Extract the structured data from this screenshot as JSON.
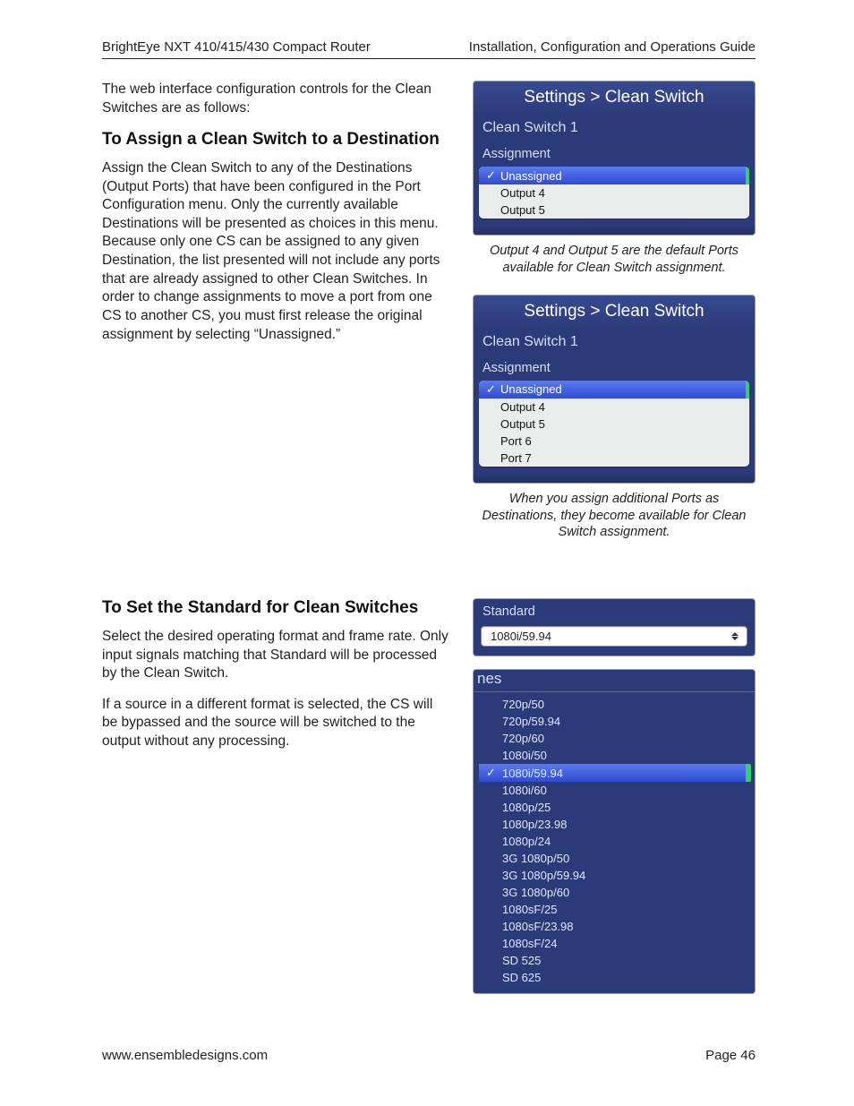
{
  "header": {
    "left": "BrightEye NXT 410/415/430 Compact Router",
    "right": "Installation, Configuration and Operations Guide"
  },
  "intro": "The web interface configuration controls for the Clean Switches are as follows:",
  "section_assign": {
    "heading": "To Assign a Clean Switch to a Destination",
    "body": "Assign the Clean Switch to any of the Destinations (Output Ports) that have been configured in the Port Configuration menu. Only the currently available Destinations will be presented as choices in this menu. Because only one CS can be assigned to any given Destination, the list presented will not include any ports that are already assigned to other Clean Switches. In order to change assignments to move a port from one CS to another CS, you must first release the original assignment by selecting “Unassigned.”"
  },
  "panel_a": {
    "title": "Settings > Clean Switch",
    "subtitle": "Clean Switch 1",
    "group": "Assignment",
    "options": [
      "Unassigned",
      "Output 4",
      "Output 5"
    ],
    "selected_index": 0,
    "caption": "Output 4 and Output 5 are the default Ports available for Clean Switch assignment."
  },
  "panel_b": {
    "title": "Settings > Clean Switch",
    "subtitle": "Clean Switch 1",
    "group": "Assignment",
    "options": [
      "Unassigned",
      "Output 4",
      "Output 5",
      "Port 6",
      "Port 7"
    ],
    "selected_index": 0,
    "caption": "When you assign additional Ports as Destinations, they become available for Clean Switch assignment."
  },
  "section_standard": {
    "heading": "To Set the Standard for Clean Switches",
    "body1": "Select the desired operating format and frame rate. Only input signals matching that Standard will be processed by the Clean Switch.",
    "body2": "If a source in a different format is selected, the CS will be bypassed and the source will be switched to the output without any processing."
  },
  "standard_select": {
    "label": "Standard",
    "value": "1080i/59.94"
  },
  "standard_list": {
    "head": "nes",
    "options": [
      "720p/50",
      "720p/59.94",
      "720p/60",
      "1080i/50",
      "1080i/59.94",
      "1080i/60",
      "1080p/25",
      "1080p/23.98",
      "1080p/24",
      "3G 1080p/50",
      "3G 1080p/59.94",
      "3G 1080p/60",
      "1080sF/25",
      "1080sF/23.98",
      "1080sF/24",
      "SD 525",
      "SD 625"
    ],
    "selected_index": 4
  },
  "footer": {
    "left": "www.ensembledesigns.com",
    "right": "Page 46"
  }
}
